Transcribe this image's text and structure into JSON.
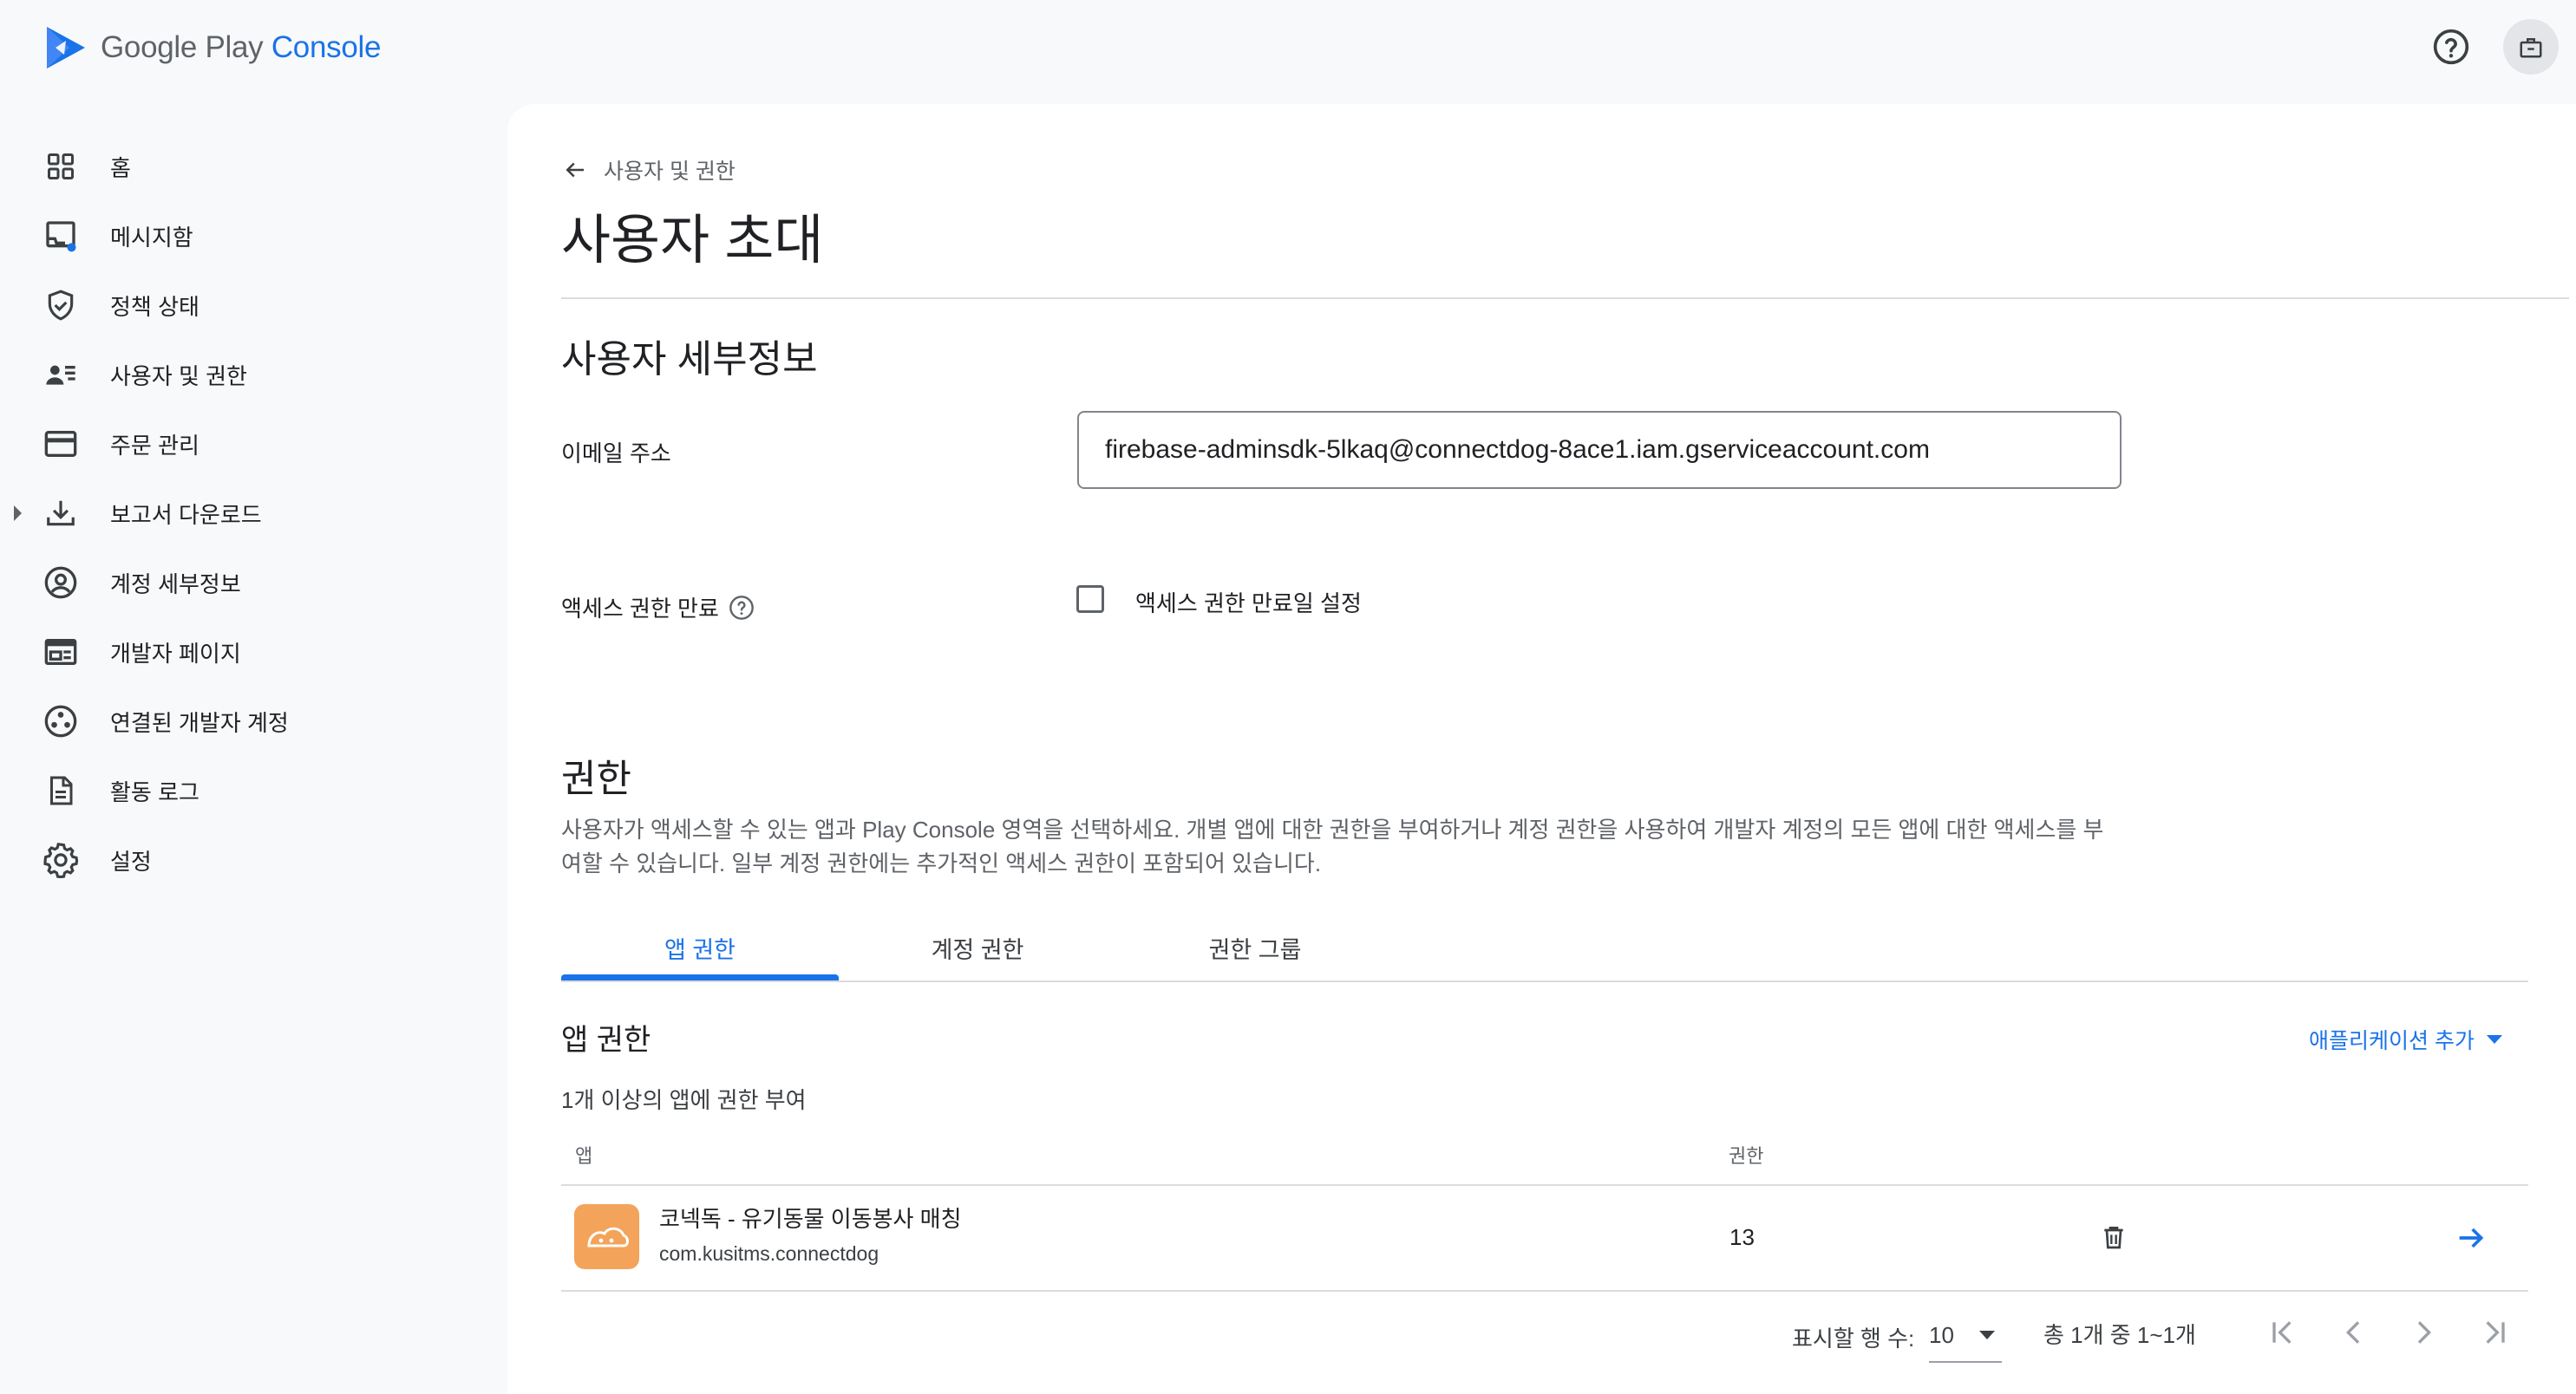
{
  "header": {
    "logo_text_main": "Google Play",
    "logo_text_accent": "Console",
    "brand_color": "#1a73e8",
    "icons": [
      "help-icon",
      "notifications-icon"
    ]
  },
  "sidebar": {
    "items": [
      {
        "label": "홈",
        "icon": "home-grid-icon"
      },
      {
        "label": "메시지함",
        "icon": "inbox-icon"
      },
      {
        "label": "정책 상태",
        "icon": "shield-check-icon"
      },
      {
        "label": "사용자 및 권한",
        "icon": "users-icon"
      },
      {
        "label": "주문 관리",
        "icon": "credit-card-icon"
      },
      {
        "label": "보고서 다운로드",
        "icon": "download-icon"
      },
      {
        "label": "계정 세부정보",
        "icon": "account-circle-icon"
      },
      {
        "label": "개발자 페이지",
        "icon": "web-page-icon"
      },
      {
        "label": "연결된 개발자 계정",
        "icon": "linked-accounts-icon"
      },
      {
        "label": "활동 로그",
        "icon": "document-icon"
      },
      {
        "label": "설정",
        "icon": "gear-icon"
      }
    ]
  },
  "breadcrumb": {
    "back_label": "사용자 및 권한"
  },
  "page": {
    "title": "사용자 초대"
  },
  "user_details": {
    "section_title": "사용자 세부정보",
    "email_label": "이메일 주소",
    "email_value": "firebase-adminsdk-5lkaq@connectdog-8ace1.iam.gserviceaccount.com",
    "expiry_label": "액세스 권한 만료",
    "expiry_checkbox_label": "액세스 권한 만료일 설정",
    "expiry_checked": false
  },
  "permissions": {
    "section_title": "권한",
    "description": "사용자가 액세스할 수 있는 앱과 Play Console 영역을 선택하세요. 개별 앱에 대한 권한을 부여하거나 계정 권한을 사용하여 개발자 계정의 모든 앱에 대한 액세스를 부여할 수 있습니다. 일부 계정 권한에는 추가적인 액세스 권한이 포함되어 있습니다.",
    "tabs": [
      {
        "label": "앱 권한",
        "active": true
      },
      {
        "label": "계정 권한",
        "active": false
      },
      {
        "label": "권한 그룹",
        "active": false
      }
    ]
  },
  "app_permissions": {
    "title": "앱 권한",
    "add_app_label": "애플리케이션 추가",
    "subtitle": "1개 이상의 앱에 권한 부여",
    "columns": {
      "app": "앱",
      "permissions": "권한"
    },
    "rows": [
      {
        "app_name": "코넥독 - 유기동물 이동봉사 매칭",
        "package": "com.kusitms.connectdog",
        "permission_count": "13"
      }
    ]
  },
  "pagination": {
    "rows_label": "표시할 행 수:",
    "rows_value": "10",
    "range_text": "총 1개 중 1~1개"
  }
}
